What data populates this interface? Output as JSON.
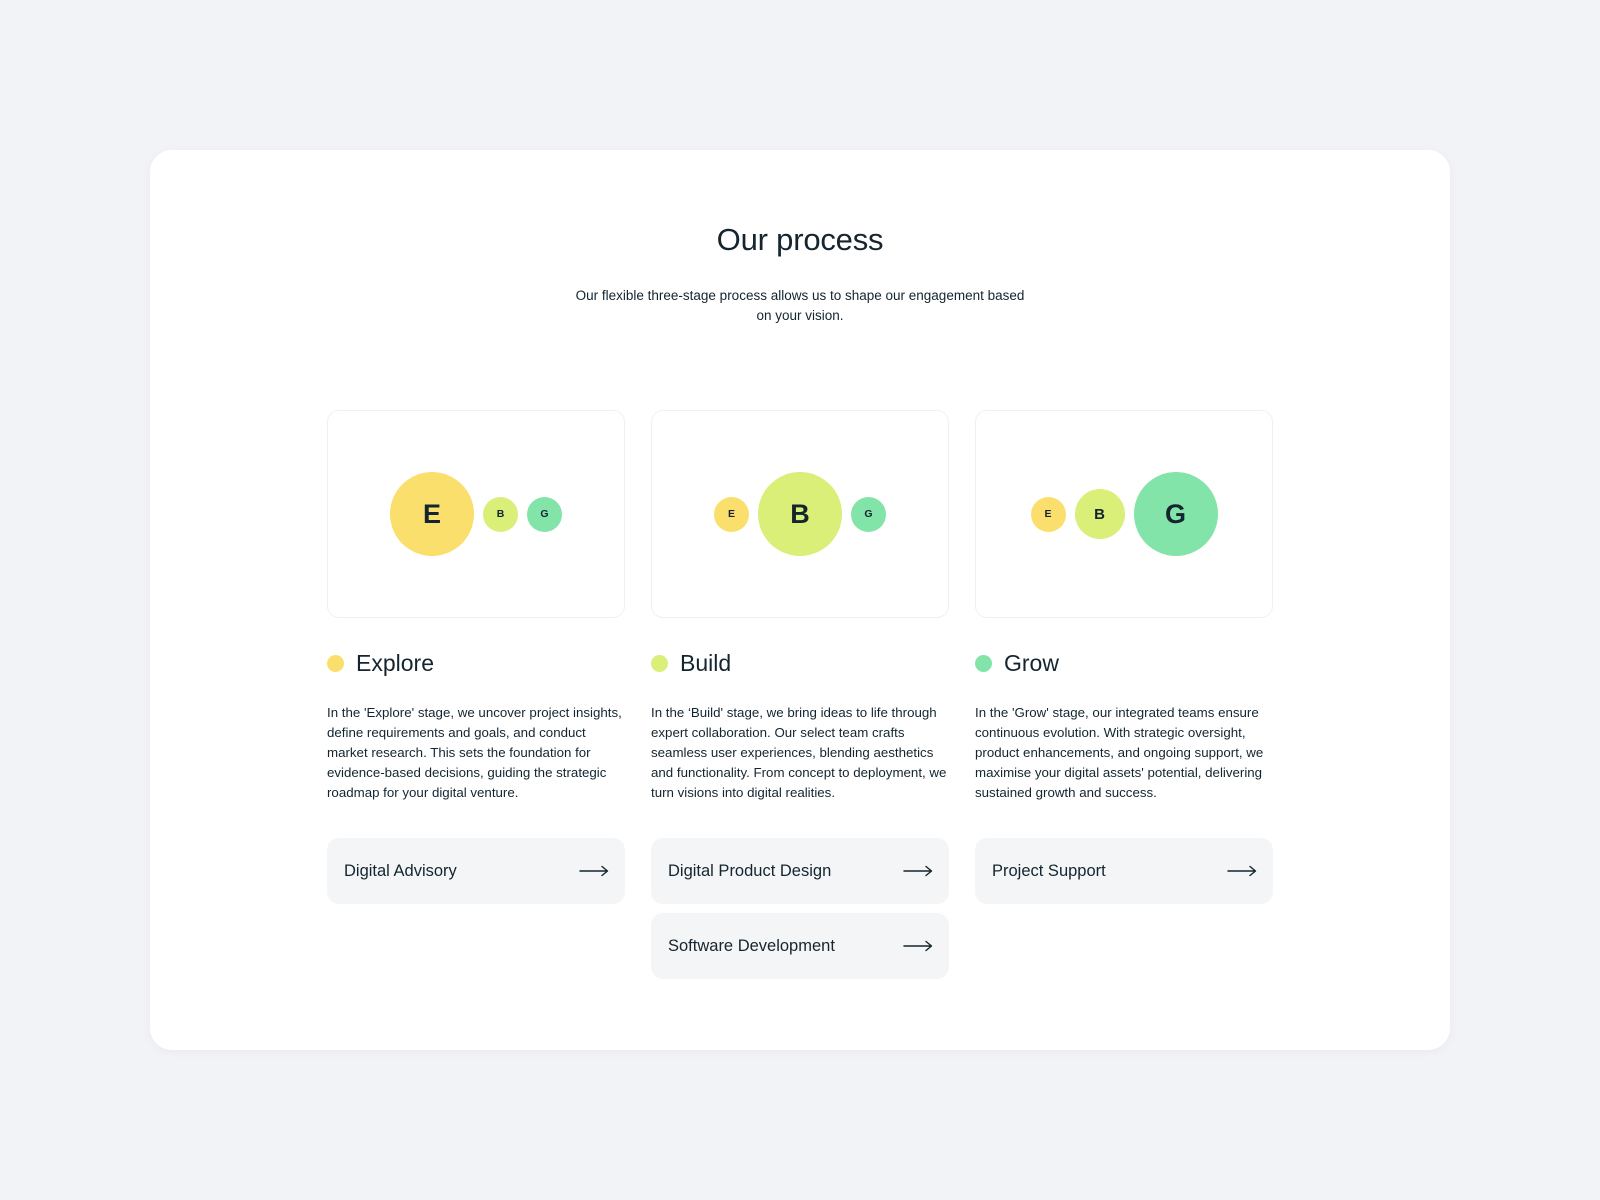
{
  "header": {
    "title": "Our process",
    "subtitle": "Our flexible three-stage process allows us to shape our engagement based on your vision."
  },
  "colors": {
    "explore": "#fbdf6c",
    "build": "#d9ef77",
    "grow": "#82e4a8",
    "text": "#14252f",
    "link_bg": "#f4f5f7"
  },
  "stages": [
    {
      "name": "Explore",
      "bubbles": [
        {
          "letter": "E",
          "size": "large"
        },
        {
          "letter": "B",
          "size": "small"
        },
        {
          "letter": "G",
          "size": "small"
        }
      ],
      "description": "In the 'Explore' stage, we uncover project insights, define requirements and goals, and conduct market research. This sets the foundation for evidence-based decisions, guiding the strategic roadmap for your digital venture.",
      "links": [
        {
          "label": "Digital Advisory",
          "icon": "arrow-right-icon"
        }
      ]
    },
    {
      "name": "Build",
      "bubbles": [
        {
          "letter": "E",
          "size": "small"
        },
        {
          "letter": "B",
          "size": "large"
        },
        {
          "letter": "G",
          "size": "small"
        }
      ],
      "description": "In the ‘Build' stage, we bring ideas to life through expert collaboration. Our select team crafts seamless user experiences, blending aesthetics and functionality. From concept to deployment, we turn visions into digital realities.",
      "links": [
        {
          "label": "Digital Product Design",
          "icon": "arrow-right-icon"
        },
        {
          "label": "Software Development",
          "icon": "arrow-right-icon"
        }
      ]
    },
    {
      "name": "Grow",
      "bubbles": [
        {
          "letter": "E",
          "size": "small"
        },
        {
          "letter": "B",
          "size": "medium"
        },
        {
          "letter": "G",
          "size": "large"
        }
      ],
      "description": "In the 'Grow' stage, our integrated teams ensure continuous evolution. With strategic oversight, product enhancements, and ongoing support, we maximise your digital assets' potential, delivering sustained growth and success.",
      "links": [
        {
          "label": "Project Support",
          "icon": "arrow-right-icon"
        }
      ]
    }
  ]
}
